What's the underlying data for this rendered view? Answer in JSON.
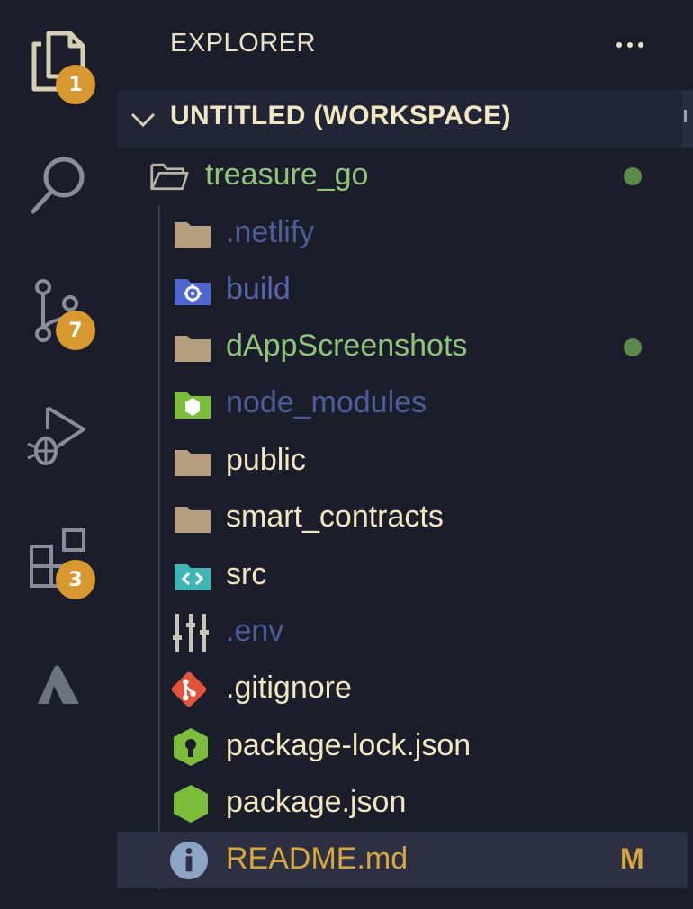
{
  "activity_bar": {
    "items": [
      {
        "name": "explorer",
        "badge": "1"
      },
      {
        "name": "search",
        "badge": ""
      },
      {
        "name": "source-control",
        "badge": "7"
      },
      {
        "name": "run-debug",
        "badge": ""
      },
      {
        "name": "extensions",
        "badge": "3"
      },
      {
        "name": "atlassian",
        "badge": ""
      }
    ]
  },
  "sidebar": {
    "title": "EXPLORER",
    "section_title": "UNTITLED (WORKSPACE)",
    "tree": [
      {
        "label": "treasure_go",
        "icon": "folder-open-icon",
        "color": "#8fc47a",
        "status": "dot",
        "status_text": ""
      },
      {
        "label": ".netlify",
        "icon": "folder-icon",
        "color": "#4d5d9a",
        "status": "",
        "status_text": ""
      },
      {
        "label": "build",
        "icon": "build-folder-icon",
        "color": "#5567a8",
        "status": "",
        "status_text": ""
      },
      {
        "label": "dAppScreenshots",
        "icon": "folder-icon",
        "color": "#8fc47a",
        "status": "dot",
        "status_text": ""
      },
      {
        "label": "node_modules",
        "icon": "node-modules-folder-icon",
        "color": "#4d5d9a",
        "status": "",
        "status_text": ""
      },
      {
        "label": "public",
        "icon": "folder-icon",
        "color": "#f1e7c3",
        "status": "",
        "status_text": ""
      },
      {
        "label": "smart_contracts",
        "icon": "folder-icon",
        "color": "#f1e7c3",
        "status": "",
        "status_text": ""
      },
      {
        "label": "src",
        "icon": "src-folder-icon",
        "color": "#f1e7c3",
        "status": "",
        "status_text": ""
      },
      {
        "label": ".env",
        "icon": "env-settings-icon",
        "color": "#4d5d9a",
        "status": "",
        "status_text": ""
      },
      {
        "label": ".gitignore",
        "icon": "git-icon",
        "color": "#f1e7c3",
        "status": "",
        "status_text": ""
      },
      {
        "label": "package-lock.json",
        "icon": "npm-lock-icon",
        "color": "#f1e7c3",
        "status": "",
        "status_text": ""
      },
      {
        "label": "package.json",
        "icon": "nodejs-hexagon-icon",
        "color": "#f1e7c3",
        "status": "",
        "status_text": ""
      },
      {
        "label": "README.md",
        "icon": "info-icon",
        "color": "#d6a740",
        "status": "letter",
        "status_text": "M"
      }
    ]
  },
  "colors": {
    "background": "#1b1d2a",
    "badge": "#d6982f",
    "selected_row": "#2d3043",
    "git_modified_dot": "#5c8a4a"
  }
}
